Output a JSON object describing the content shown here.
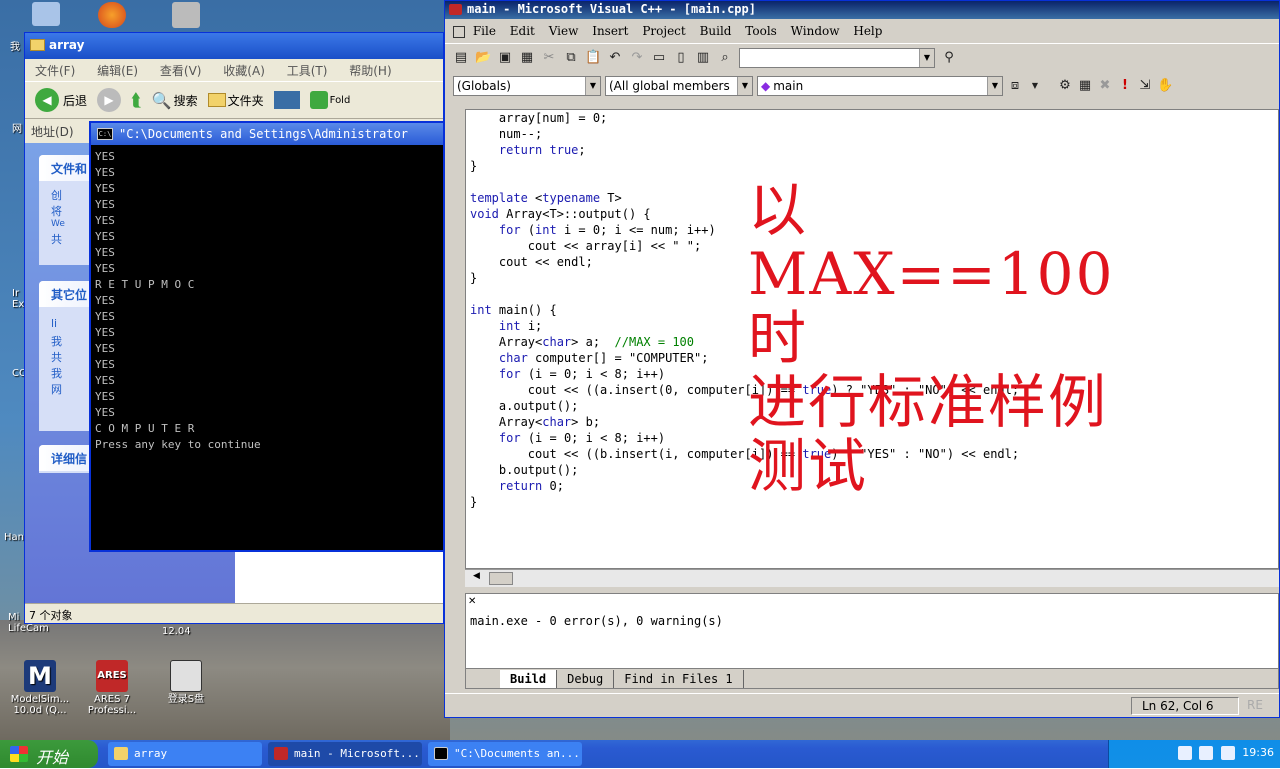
{
  "desktop": {
    "icons": [
      {
        "label": "ModelSim...\n10.0d (Q...",
        "name": "modelsim",
        "color": "#1d3a7a"
      },
      {
        "label": "ARES 7\nProfessi...",
        "name": "ares",
        "color": "#c02828"
      },
      {
        "label": "登录S盘",
        "name": "s-drive",
        "color": "#e0e0e0"
      }
    ],
    "edge_texts": [
      "我",
      "网",
      "Ir\nEx",
      "CO",
      "Han",
      "Mi\nLifeCam",
      "12.04"
    ]
  },
  "explorer": {
    "title": "array",
    "menu": [
      "文件(F)",
      "编辑(E)",
      "查看(V)",
      "收藏(A)",
      "工具(T)",
      "帮助(H)"
    ],
    "toolbar": {
      "back": "后退",
      "search": "搜索",
      "folders": "文件夹",
      "folder_cut": "Fold"
    },
    "address_label": "地址(D)",
    "pane1_title": "文件和",
    "pane1_items": [
      "创",
      "将",
      "We",
      "共"
    ],
    "pane2_title": "其它位",
    "pane2_items": [
      "li",
      "我",
      "共",
      "我",
      "网"
    ],
    "pane3_title": "详细信",
    "status": "7 个对象"
  },
  "console": {
    "title": "\"C:\\Documents and Settings\\Administrator",
    "lines": [
      "YES",
      "YES",
      "YES",
      "YES",
      "YES",
      "YES",
      "YES",
      "YES",
      "R E T U P M O C",
      "YES",
      "YES",
      "YES",
      "YES",
      "YES",
      "YES",
      "YES",
      "YES",
      "C O M P U T E R",
      "Press any key to continue"
    ]
  },
  "vc": {
    "title": "main - Microsoft Visual C++ - [main.cpp]",
    "menu": [
      "File",
      "Edit",
      "View",
      "Insert",
      "Project",
      "Build",
      "Tools",
      "Window",
      "Help"
    ],
    "combo_globals": "(Globals)",
    "combo_members": "(All global members",
    "combo_main": "main",
    "code_lines": [
      "    array[num] = 0;",
      "    num--;",
      "    return true;",
      "}",
      "",
      "template <typename T>",
      "void Array<T>::output() {",
      "    for (int i = 0; i <= num; i++)",
      "        cout << array[i] << \" \";",
      "    cout << endl;",
      "}",
      "",
      "int main() {",
      "    int i;",
      "    Array<char> a;  //MAX = 100",
      "    char computer[] = \"COMPUTER\";",
      "    for (i = 0; i < 8; i++)",
      "        cout << ((a.insert(0, computer[i]) == true) ? \"YES\" : \"NO\") << endl;",
      "    a.output();",
      "    Array<char> b;",
      "    for (i = 0; i < 8; i++)",
      "        cout << ((b.insert(i, computer[i]) == true) ? \"YES\" : \"NO\") << endl;",
      "    b.output();",
      "    return 0;",
      "}"
    ],
    "annotation_lines": [
      "以MAX==100时",
      "进行标准样例",
      "测试"
    ],
    "output_text": "main.exe - 0 error(s), 0 warning(s)",
    "output_tabs": [
      "Build",
      "Debug",
      "Find in Files 1"
    ],
    "status_position": "Ln 62, Col 6",
    "status_re": "RE"
  },
  "taskbar": {
    "start_label": "开始",
    "tasks": [
      {
        "label": "array",
        "name": "task-array",
        "color": "#f2d26a"
      },
      {
        "label": "main - Microsoft...",
        "name": "task-vc",
        "color": "#c02828"
      },
      {
        "label": "\"C:\\Documents an...",
        "name": "task-console",
        "color": "#000000"
      }
    ],
    "clock": "19:36"
  },
  "colors": {
    "annotation_red": "#e0141e",
    "xp_blue": "#0831d9",
    "keyword_blue": "#1a1ab0",
    "comment_green": "#008000"
  }
}
